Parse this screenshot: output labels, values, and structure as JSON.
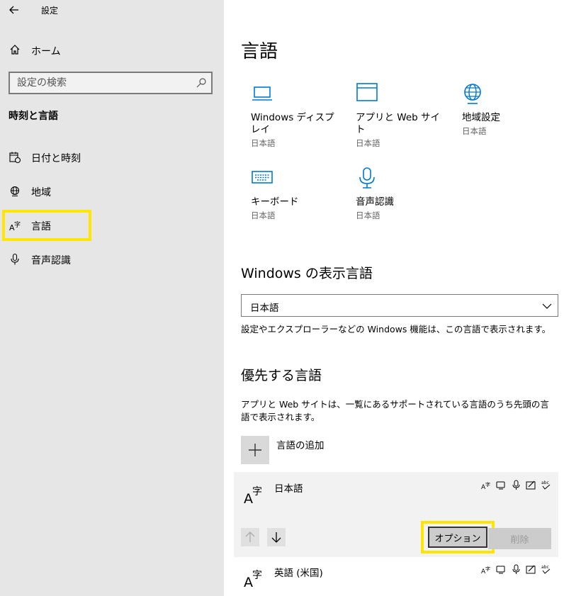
{
  "window": {
    "title": "設定"
  },
  "sidebar": {
    "home_label": "ホーム",
    "search_placeholder": "設定の検索",
    "section_header": "時刻と言語",
    "items": [
      {
        "label": "日付と時刻",
        "icon": "calendar-clock-icon"
      },
      {
        "label": "地域",
        "icon": "globe-region-icon"
      },
      {
        "label": "言語",
        "icon": "language-icon"
      },
      {
        "label": "音声認識",
        "icon": "microphone-icon"
      }
    ]
  },
  "main": {
    "title": "言語",
    "tiles": [
      {
        "name": "Windows ディスプレイ",
        "sub": "日本語",
        "icon": "laptop-display-icon"
      },
      {
        "name": "アプリと Web サイト",
        "sub": "日本語",
        "icon": "browser-window-icon"
      },
      {
        "name": "地域設定",
        "sub": "日本語",
        "icon": "globe-settings-icon"
      },
      {
        "name": "キーボード",
        "sub": "日本語",
        "icon": "keyboard-icon"
      },
      {
        "name": "音声認識",
        "sub": "日本語",
        "icon": "microphone-icon"
      }
    ],
    "display_lang": {
      "heading": "Windows の表示言語",
      "selected": "日本語",
      "description": "設定やエクスプローラーなどの Windows 機能は、この言語で表示されます。"
    },
    "preferred": {
      "heading": "優先する言語",
      "description": "アプリと Web サイトは、一覧にあるサポートされている言語のうち先頭の言語で表示されます。",
      "add_label": "言語の追加",
      "languages": [
        {
          "name": "日本語"
        },
        {
          "name": "英語 (米国)"
        }
      ],
      "options_label": "オプション",
      "remove_label": "削除"
    }
  },
  "colors": {
    "accent": "#0078d7",
    "highlight": "#ffe600"
  }
}
